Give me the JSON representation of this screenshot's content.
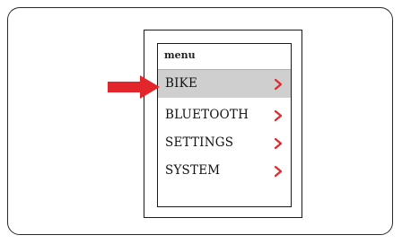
{
  "menu": {
    "title": "menu",
    "items": [
      {
        "label": "BIKE",
        "selected": true
      },
      {
        "label": "BLUETOOTH",
        "selected": false
      },
      {
        "label": "SETTINGS",
        "selected": false
      },
      {
        "label": "SYSTEM",
        "selected": false
      }
    ]
  },
  "icons": {
    "chevron": "chevron-right-icon",
    "pointer": "arrow-right-icon"
  },
  "colors": {
    "accent": "#e3262b",
    "selected_background": "#cfcfcf",
    "frame": "#1a1a1a"
  }
}
